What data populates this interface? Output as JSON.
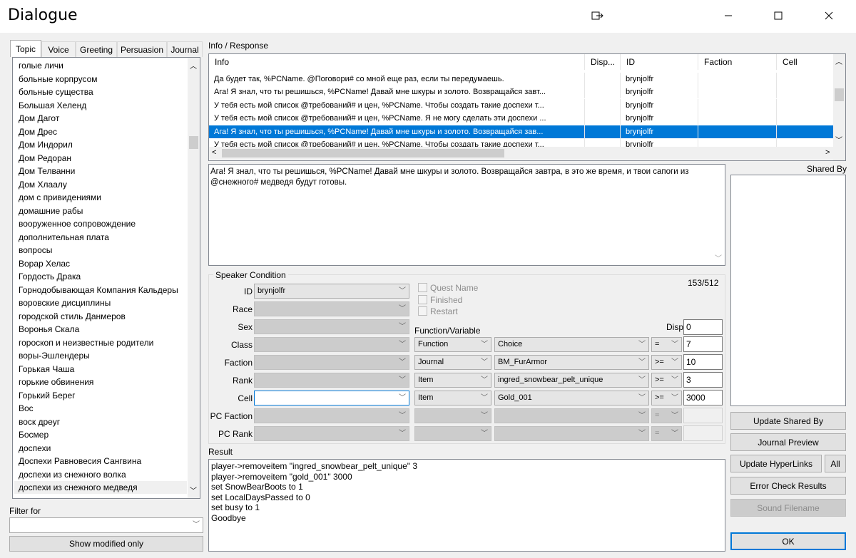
{
  "window": {
    "title": "Dialogue"
  },
  "tabs": [
    "Topic",
    "Voice",
    "Greeting",
    "Persuasion",
    "Journal"
  ],
  "topics": [
    "голые личи",
    "больные корпрусом",
    "больные существа",
    "Большая Хеленд",
    "Дом Дагот",
    "Дом Дрес",
    "Дом Индорил",
    "Дом Редоран",
    "Дом Телванни",
    "Дом Хлаалу",
    "дом с привидениями",
    "домашние рабы",
    "вооруженное сопровождение",
    "дополнительная плата",
    "вопросы",
    "Ворар Хелас",
    "Гордость Драка",
    "Горнодобывающая Компания Кальдеры",
    "воровские дисциплины",
    "городской стиль Данмеров",
    "Воронья Скала",
    "гороскоп и неизвестные родители",
    "воры-Эшлендеры",
    "Горькая Чаша",
    "горькие обвинения",
    "Горький Берег",
    "Вос",
    "воск дреуг",
    "Босмер",
    "доспехи",
    "Доспехи Равновесия Сангвина",
    "доспехи из снежного волка",
    "доспехи из снежного медведя"
  ],
  "filter": {
    "label": "Filter for",
    "value": ""
  },
  "show_modified_label": "Show modified only",
  "info_response": {
    "label": "Info / Response",
    "columns": [
      "Info",
      "Disp...",
      "ID",
      "Faction",
      "Cell"
    ],
    "rows": [
      {
        "info": "Да будет так, %PCName.  @Поговори# со мной еще раз, если ты передумаешь.",
        "disp": "",
        "id": "brynjolfr",
        "faction": "",
        "cell": ""
      },
      {
        "info": "Ага!  Я знал, что ты решишься, %PCName!  Давай мне шкуры и золото.  Возвращайся завт...",
        "disp": "",
        "id": "brynjolfr",
        "faction": "",
        "cell": ""
      },
      {
        "info": "У тебя есть мой список @требований# и цен, %PCName.  Чтобы создать такие доспехи т...",
        "disp": "",
        "id": "brynjolfr",
        "faction": "",
        "cell": ""
      },
      {
        "info": "У тебя есть мой список @требований# и цен, %PCName.  Я не могу сделать эти доспехи ...",
        "disp": "",
        "id": "brynjolfr",
        "faction": "",
        "cell": ""
      },
      {
        "info": "Ага!  Я знал, что ты решишься, %PCName!  Давай мне шкуры и золото.  Возвращайся зав...",
        "disp": "",
        "id": "brynjolfr",
        "faction": "",
        "cell": ""
      },
      {
        "info": "У тебя есть мой список @требований# и цен, %PCName.  Чтобы создать такие доспехи т...",
        "disp": "",
        "id": "brynjolfr",
        "faction": "",
        "cell": ""
      }
    ],
    "selected_index": 4,
    "response_text": "Ага!  Я знал, что ты решишься, %PCName!  Давай мне шкуры и золото.  Возвращайся завтра, в это же время, и твои сапоги из @снежного# медведя будут готовы."
  },
  "shared_by": {
    "label": "Shared By"
  },
  "speaker_condition": {
    "label": "Speaker Condition",
    "counter": "153/512",
    "fields": {
      "id_label": "ID",
      "id_value": "brynjolfr",
      "race_label": "Race",
      "sex_label": "Sex",
      "class_label": "Class",
      "faction_label": "Faction",
      "rank_label": "Rank",
      "cell_label": "Cell",
      "pc_faction_label": "PC Faction",
      "pc_rank_label": "PC Rank"
    },
    "checkboxes": [
      "Quest Name",
      "Finished",
      "Restart"
    ],
    "func_var_label": "Function/Variable",
    "disp_label": "Disp",
    "disp_value": "0",
    "functions": [
      {
        "type": "Function",
        "name": "Choice",
        "op": "=",
        "value": "7"
      },
      {
        "type": "Journal",
        "name": "BM_FurArmor",
        "op": ">=",
        "value": "10"
      },
      {
        "type": "Item",
        "name": "ingred_snowbear_pelt_unique",
        "op": ">=",
        "value": "3"
      },
      {
        "type": "Item",
        "name": "Gold_001",
        "op": ">=",
        "value": "3000"
      },
      {
        "type": "",
        "name": "",
        "op": "=",
        "value": ""
      },
      {
        "type": "",
        "name": "",
        "op": "=",
        "value": ""
      }
    ]
  },
  "result": {
    "label": "Result",
    "lines": [
      "player->removeitem \"ingred_snowbear_pelt_unique\" 3",
      "player->removeitem \"gold_001\" 3000",
      "set SnowBearBoots to 1",
      "set LocalDaysPassed to 0",
      "set busy to 1",
      "Goodbye"
    ]
  },
  "buttons": {
    "update_shared_by": "Update Shared By",
    "journal_preview": "Journal Preview",
    "update_hyperlinks": "Update HyperLinks",
    "all": "All",
    "error_check": "Error Check Results",
    "sound_filename": "Sound Filename",
    "ok": "OK"
  },
  "colors": {
    "selection": "#0078d7",
    "window_bg": "#f0f0f0"
  }
}
